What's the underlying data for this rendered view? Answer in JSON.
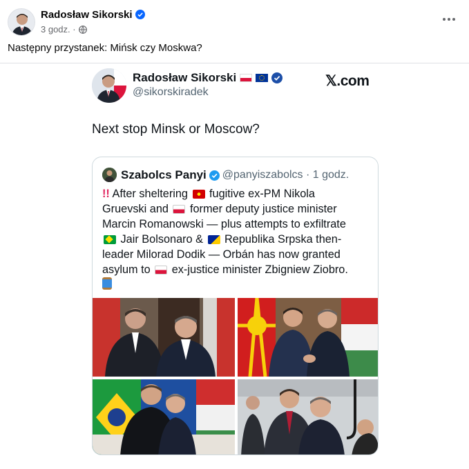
{
  "post": {
    "author": "Radosław Sikorski",
    "time": "3 godz. ·",
    "text": "Następny przystanek: Mińsk czy Moskwa?"
  },
  "tweet": {
    "name": "Radosław Sikorski",
    "handle": "@sikorskiradek",
    "source": "𝕏.com",
    "text": "Next stop Minsk or Moscow?"
  },
  "quote": {
    "name": "Szabolcs Panyi",
    "handle_time": "@panyiszabolcs · 1 godz.",
    "lines": [
      {
        "a": "!!",
        "b": " After sheltering ",
        "c": " fugitive ex-PM Nikola"
      },
      {
        "a": "Gruevski and ",
        "b": " former deputy justice minister"
      },
      {
        "a": "Marcin Romanowski — plus attempts to exfiltrate"
      },
      {
        "a": " Jair Bolsonaro & ",
        "b": " Republika Srpska then-"
      },
      {
        "a": "leader Milorad Dodik — Orbán has now granted"
      },
      {
        "a": "asylum to ",
        "b": " ex-justice minister Zbigniew Ziobro."
      }
    ]
  },
  "icons": {
    "verified": "verified-badge-icon",
    "globe": "globe-icon",
    "more": "more-options-icon"
  },
  "colors": {
    "fb_verified": "#0866ff",
    "x_verified": "#1d9bf0",
    "text_secondary": "#65676b"
  }
}
